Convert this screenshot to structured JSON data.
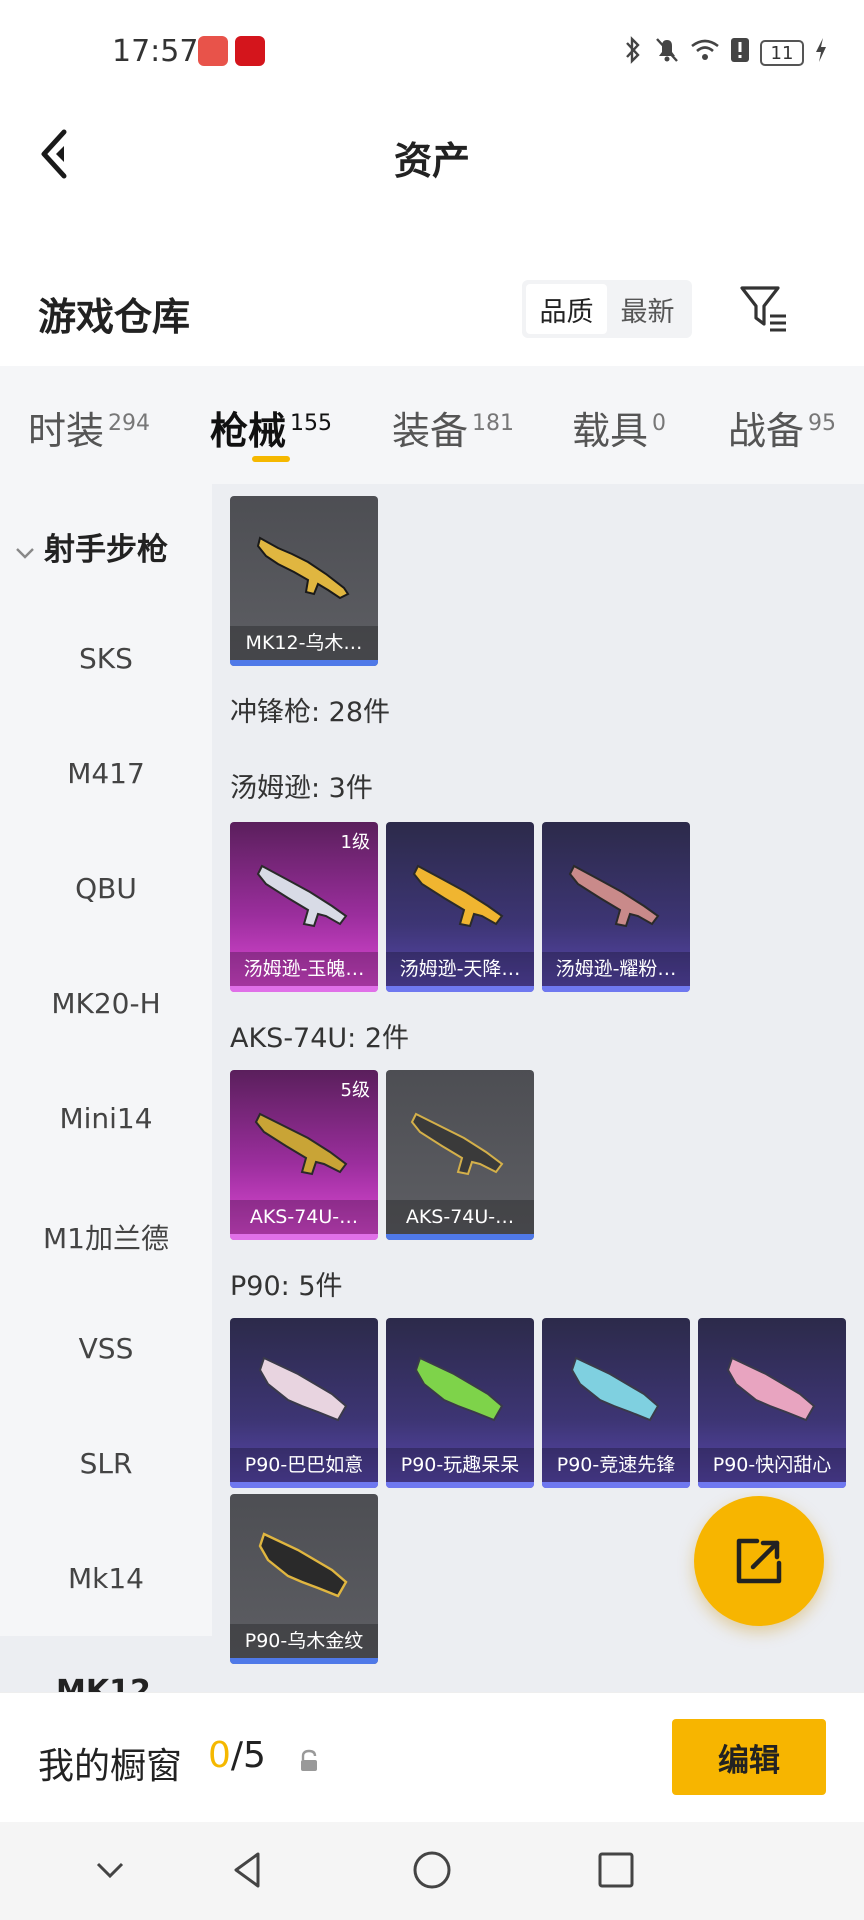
{
  "status_bar": {
    "time": "17:57",
    "battery": "11"
  },
  "header": {
    "title": "资产"
  },
  "warehouse": {
    "title": "游戏仓库",
    "sort_options": [
      "品质",
      "最新"
    ],
    "sort_selected": "品质"
  },
  "tabs": [
    {
      "label": "时装",
      "count": "294"
    },
    {
      "label": "枪械",
      "count": "155",
      "active": true
    },
    {
      "label": "装备",
      "count": "181"
    },
    {
      "label": "载具",
      "count": "0"
    },
    {
      "label": "战备",
      "count": "95"
    }
  ],
  "sidebar": {
    "category": "射手步枪",
    "items": [
      "SKS",
      "M417",
      "QBU",
      "MK20-H",
      "Mini14",
      "M1加兰德",
      "VSS",
      "SLR",
      "Mk14"
    ],
    "next_item_partial": "MK12"
  },
  "content": {
    "top_card": {
      "name": "MK12-乌木…"
    },
    "smg_header": "冲锋枪: 28件",
    "groups": [
      {
        "label": "汤姆逊: 3件",
        "cards": [
          {
            "name": "汤姆逊-玉魄…",
            "level": "1级"
          },
          {
            "name": "汤姆逊-天降…"
          },
          {
            "name": "汤姆逊-耀粉…"
          }
        ]
      },
      {
        "label": "AKS-74U: 2件",
        "cards": [
          {
            "name": "AKS-74U-…",
            "level": "5级"
          },
          {
            "name": "AKS-74U-…"
          }
        ]
      },
      {
        "label": "P90: 5件",
        "cards": [
          {
            "name": "P90-巴巴如意"
          },
          {
            "name": "P90-玩趣呆呆"
          },
          {
            "name": "P90-竞速先锋"
          },
          {
            "name": "P90-快闪甜心"
          },
          {
            "name": "P90-乌木金纹"
          }
        ]
      }
    ]
  },
  "bottom": {
    "label": "我的橱窗",
    "count_current": "0",
    "count_total": "/5",
    "edit_label": "编辑"
  },
  "colors": {
    "accent": "#f7b500",
    "tab_indicator": "#f5b800"
  }
}
